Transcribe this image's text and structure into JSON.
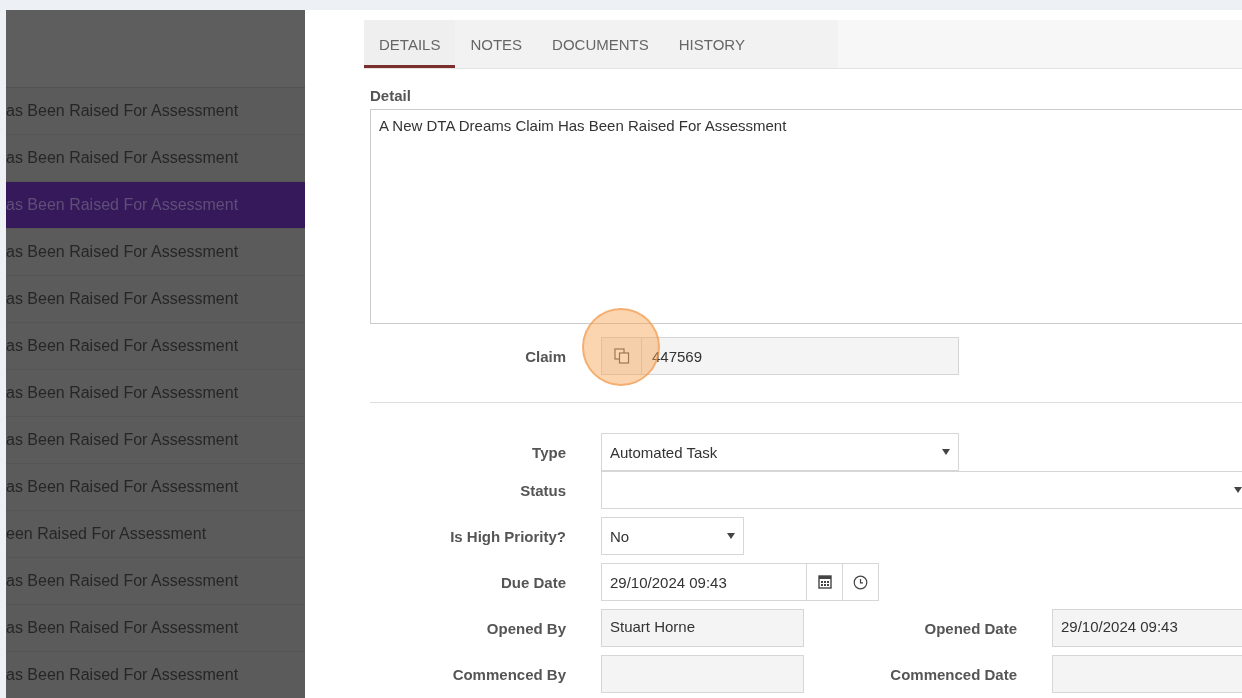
{
  "sidebar": {
    "items": [
      {
        "label": "as Been Raised For Assessment",
        "selected": false
      },
      {
        "label": "as Been Raised For Assessment",
        "selected": false
      },
      {
        "label": "as Been Raised For Assessment",
        "selected": true
      },
      {
        "label": "as Been Raised For Assessment",
        "selected": false
      },
      {
        "label": "as Been Raised For Assessment",
        "selected": false
      },
      {
        "label": "as Been Raised For Assessment",
        "selected": false
      },
      {
        "label": "as Been Raised For Assessment",
        "selected": false
      },
      {
        "label": "as Been Raised For Assessment",
        "selected": false
      },
      {
        "label": "as Been Raised For Assessment",
        "selected": false
      },
      {
        "label": "een Raised For Assessment",
        "selected": false
      },
      {
        "label": "as Been Raised For Assessment",
        "selected": false
      },
      {
        "label": "as Been Raised For Assessment",
        "selected": false
      },
      {
        "label": "as Been Raised For Assessment",
        "selected": false
      }
    ]
  },
  "tabs": [
    {
      "label": "DETAILS",
      "selected": true
    },
    {
      "label": "NOTES",
      "selected": false
    },
    {
      "label": "DOCUMENTS",
      "selected": false
    },
    {
      "label": "HISTORY",
      "selected": false
    }
  ],
  "detail": {
    "label": "Detail",
    "value": "A New DTA Dreams Claim Has Been Raised For Assessment"
  },
  "claim": {
    "label": "Claim",
    "value": "447569"
  },
  "fields": {
    "type": {
      "label": "Type",
      "value": "Automated Task",
      "kind": "select"
    },
    "status": {
      "label": "Status",
      "kind": "select"
    },
    "high_priority": {
      "label": "Is High Priority?",
      "value": "No",
      "kind": "select"
    },
    "due_date": {
      "label": "Due Date",
      "value": "29/10/2024 09:43",
      "kind": "datetime"
    },
    "opened_by": {
      "label": "Opened By",
      "value": "Stuart Horne",
      "kind": "readonly"
    },
    "opened_date": {
      "label": "Opened Date",
      "value": "29/10/2024 09:43",
      "kind": "readonly"
    },
    "commenced_by": {
      "label": "Commenced By",
      "kind": "readonly"
    },
    "commenced_date": {
      "label": "Commenced Date",
      "kind": "readonly"
    }
  }
}
